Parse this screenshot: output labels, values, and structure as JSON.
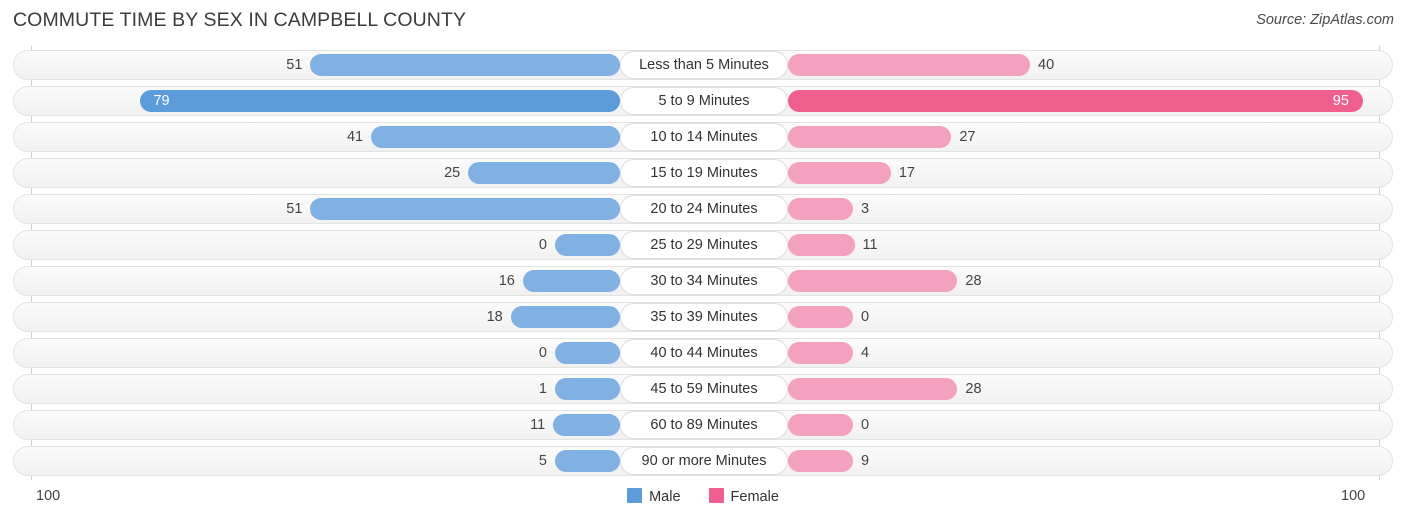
{
  "header": {
    "title": "COMMUTE TIME BY SEX IN CAMPBELL COUNTY",
    "source": "Source: ZipAtlas.com"
  },
  "footer": {
    "axis_max_left": "100",
    "axis_max_right": "100"
  },
  "legend": [
    {
      "label": "Male",
      "color": "#5b9bd9"
    },
    {
      "label": "Female",
      "color": "#ef5f8e"
    }
  ],
  "colors": {
    "male": "#7fb1e3",
    "male_highlight": "#5b9bd9",
    "female": "#f3a1be",
    "female_highlight": "#ef5f8e",
    "track": "#f6f6f6",
    "track_border": "#e3e3e3"
  },
  "chart_data": {
    "type": "bar",
    "subtype": "diverging-bidirectional",
    "title": "COMMUTE TIME BY SEX IN CAMPBELL COUNTY",
    "xlabel": "",
    "ylabel": "",
    "xlim": [
      100,
      100
    ],
    "grid": false,
    "legend_position": "bottom-center",
    "axis_max_left": 100,
    "axis_max_right": 100,
    "categories": [
      "Less than 5 Minutes",
      "5 to 9 Minutes",
      "10 to 14 Minutes",
      "15 to 19 Minutes",
      "20 to 24 Minutes",
      "25 to 29 Minutes",
      "30 to 34 Minutes",
      "35 to 39 Minutes",
      "40 to 44 Minutes",
      "45 to 59 Minutes",
      "60 to 89 Minutes",
      "90 or more Minutes"
    ],
    "series": [
      {
        "name": "Male",
        "values": [
          51,
          79,
          41,
          25,
          51,
          0,
          16,
          18,
          0,
          1,
          11,
          5
        ]
      },
      {
        "name": "Female",
        "values": [
          40,
          95,
          27,
          17,
          3,
          11,
          28,
          0,
          4,
          28,
          0,
          9
        ]
      }
    ]
  },
  "rows": [
    {
      "category": "Less than 5 Minutes",
      "male": "51",
      "female": "40",
      "male_hi": false,
      "female_hi": false
    },
    {
      "category": "5 to 9 Minutes",
      "male": "79",
      "female": "95",
      "male_hi": true,
      "female_hi": true
    },
    {
      "category": "10 to 14 Minutes",
      "male": "41",
      "female": "27",
      "male_hi": false,
      "female_hi": false
    },
    {
      "category": "15 to 19 Minutes",
      "male": "25",
      "female": "17",
      "male_hi": false,
      "female_hi": false
    },
    {
      "category": "20 to 24 Minutes",
      "male": "51",
      "female": "3",
      "male_hi": false,
      "female_hi": false
    },
    {
      "category": "25 to 29 Minutes",
      "male": "0",
      "female": "11",
      "male_hi": false,
      "female_hi": false
    },
    {
      "category": "30 to 34 Minutes",
      "male": "16",
      "female": "28",
      "male_hi": false,
      "female_hi": false
    },
    {
      "category": "35 to 39 Minutes",
      "male": "18",
      "female": "0",
      "male_hi": false,
      "female_hi": false
    },
    {
      "category": "40 to 44 Minutes",
      "male": "0",
      "female": "4",
      "male_hi": false,
      "female_hi": false
    },
    {
      "category": "45 to 59 Minutes",
      "male": "1",
      "female": "28",
      "male_hi": false,
      "female_hi": false
    },
    {
      "category": "60 to 89 Minutes",
      "male": "11",
      "female": "0",
      "male_hi": false,
      "female_hi": false
    },
    {
      "category": "90 or more Minutes",
      "male": "5",
      "female": "9",
      "male_hi": false,
      "female_hi": false
    }
  ]
}
